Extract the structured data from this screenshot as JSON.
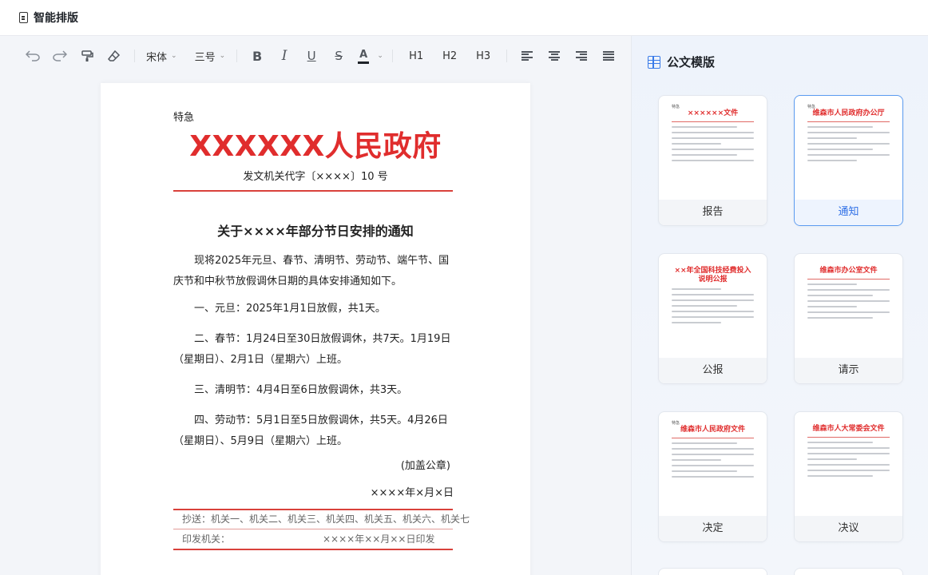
{
  "app": {
    "title": "智能排版"
  },
  "toolbar": {
    "font_family": "宋体",
    "font_size": "三号",
    "bold": "B",
    "italic": "I",
    "underline": "U",
    "strike": "S",
    "color_letter": "A",
    "h1": "H1",
    "h2": "H2",
    "h3": "H3"
  },
  "document": {
    "urgency": "特急",
    "gov_title": "XXXXXX人民政府",
    "doc_number": "发文机关代字〔××××〕10 号",
    "notice_title": "关于××××年部分节日安排的通知",
    "intro": "现将2025年元旦、春节、清明节、劳动节、端午节、国庆节和中秋节放假调休日期的具体安排通知如下。",
    "items": [
      "一、元旦：2025年1月1日放假，共1天。",
      "二、春节：1月24日至30日放假调休，共7天。1月19日（星期日）、2月1日（星期六）上班。",
      "三、清明节：4月4日至6日放假调休，共3天。",
      "四、劳动节：5月1日至5日放假调休，共5天。4月26日（星期日）、5月9日（星期六）上班。"
    ],
    "seal": "(加盖公章)",
    "date": "××××年×月×日",
    "cc": "抄送：机关一、机关二、机关三、机关四、机关五、机关六、机关七",
    "print_label": "印发机关：",
    "print_date": "××××年××月××日印发"
  },
  "sidebar": {
    "title": "公文模版",
    "templates": [
      {
        "label": "报告",
        "header": "××××××文件"
      },
      {
        "label": "通知",
        "header": "维森市人民政府办公厅"
      },
      {
        "label": "公报",
        "header": "××年全国科技经费投入说明公报"
      },
      {
        "label": "请示",
        "header": "维森市办公室文件"
      },
      {
        "label": "决定",
        "header": "维森市人民政府文件"
      },
      {
        "label": "决议",
        "header": "维森市人大常委会文件"
      }
    ],
    "selected": "通知"
  },
  "colors": {
    "accent": "#2f6fe6",
    "gov_red": "#e02d2d"
  },
  "icons": [
    "document-icon",
    "undo-icon",
    "redo-icon",
    "format-painter-icon",
    "eraser-icon",
    "align-left-icon",
    "align-center-icon",
    "align-right-icon",
    "align-justify-icon",
    "template-grid-icon"
  ]
}
